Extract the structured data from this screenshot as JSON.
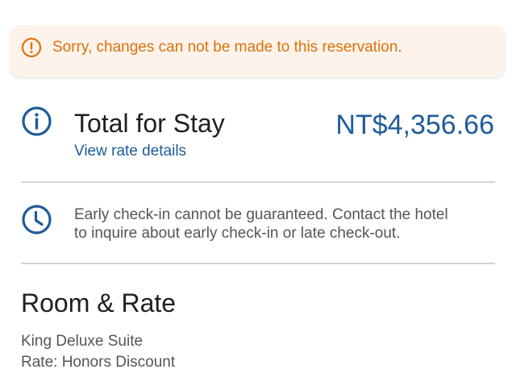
{
  "alert": {
    "icon": "info-circle-icon",
    "message": "Sorry, changes can not be made to this reservation.",
    "color": "#d9720c",
    "background": "#fdf3ea"
  },
  "total": {
    "icon": "info-circle-icon",
    "title": "Total for Stay",
    "link_label": "View rate details",
    "price": "NT$4,356.66",
    "accent_color": "#1f5b99"
  },
  "checkin": {
    "icon": "clock-icon",
    "line1": "Early check-in cannot be guaranteed. Contact the hotel",
    "line2": "to inquire about early check-in or late check-out."
  },
  "room": {
    "heading": "Room & Rate",
    "name": "King Deluxe Suite",
    "rate": "Rate: Honors Discount"
  }
}
